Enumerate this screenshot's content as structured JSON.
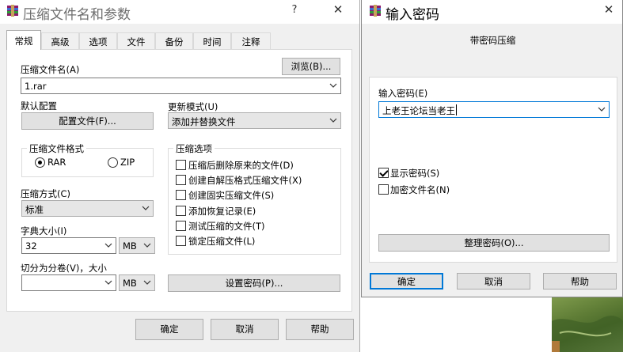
{
  "main_dialog": {
    "title": "压缩文件名和参数",
    "help_glyph": "?",
    "close_glyph": "✕",
    "tabs": [
      {
        "label": "常规",
        "active": true
      },
      {
        "label": "高级"
      },
      {
        "label": "选项"
      },
      {
        "label": "文件"
      },
      {
        "label": "备份"
      },
      {
        "label": "时间"
      },
      {
        "label": "注释"
      }
    ],
    "archive_name_label": "压缩文件名(A)",
    "browse_button": "浏览(B)...",
    "archive_name_value": "1.rar",
    "default_profile_label": "默认配置",
    "profiles_button": "配置文件(F)...",
    "update_mode_label": "更新模式(U)",
    "update_mode_value": "添加并替换文件",
    "format_group": {
      "title": "压缩文件格式",
      "options": [
        {
          "label": "RAR",
          "checked": true
        },
        {
          "label": "ZIP",
          "checked": false
        }
      ]
    },
    "options_group": {
      "title": "压缩选项",
      "items": [
        {
          "label": "压缩后删除原来的文件(D)",
          "checked": false
        },
        {
          "label": "创建自解压格式压缩文件(X)",
          "checked": false
        },
        {
          "label": "创建固实压缩文件(S)",
          "checked": false
        },
        {
          "label": "添加恢复记录(E)",
          "checked": false
        },
        {
          "label": "测试压缩的文件(T)",
          "checked": false
        },
        {
          "label": "锁定压缩文件(L)",
          "checked": false
        }
      ]
    },
    "method_label": "压缩方式(C)",
    "method_value": "标准",
    "dict_label": "字典大小(I)",
    "dict_value": "32",
    "dict_unit": "MB",
    "split_label": "切分为分卷(V)，大小",
    "split_value": "",
    "split_unit": "MB",
    "set_password_button": "设置密码(P)...",
    "ok_button": "确定",
    "cancel_button": "取消",
    "help_button": "帮助"
  },
  "password_dialog": {
    "title": "输入密码",
    "close_glyph": "✕",
    "subtitle": "带密码压缩",
    "enter_label": "输入密码(E)",
    "password_value": "上老王论坛当老王",
    "show_password": {
      "label": "显示密码(S)",
      "checked": true
    },
    "encrypt_names": {
      "label": "加密文件名(N)",
      "checked": false
    },
    "organize_button": "整理密码(O)...",
    "ok_button": "确定",
    "cancel_button": "取消",
    "help_button": "帮助"
  },
  "colors": {
    "dialog_bg": "#f0f0f0",
    "accent": "#0078d7",
    "button_bg": "#e1e1e1"
  }
}
